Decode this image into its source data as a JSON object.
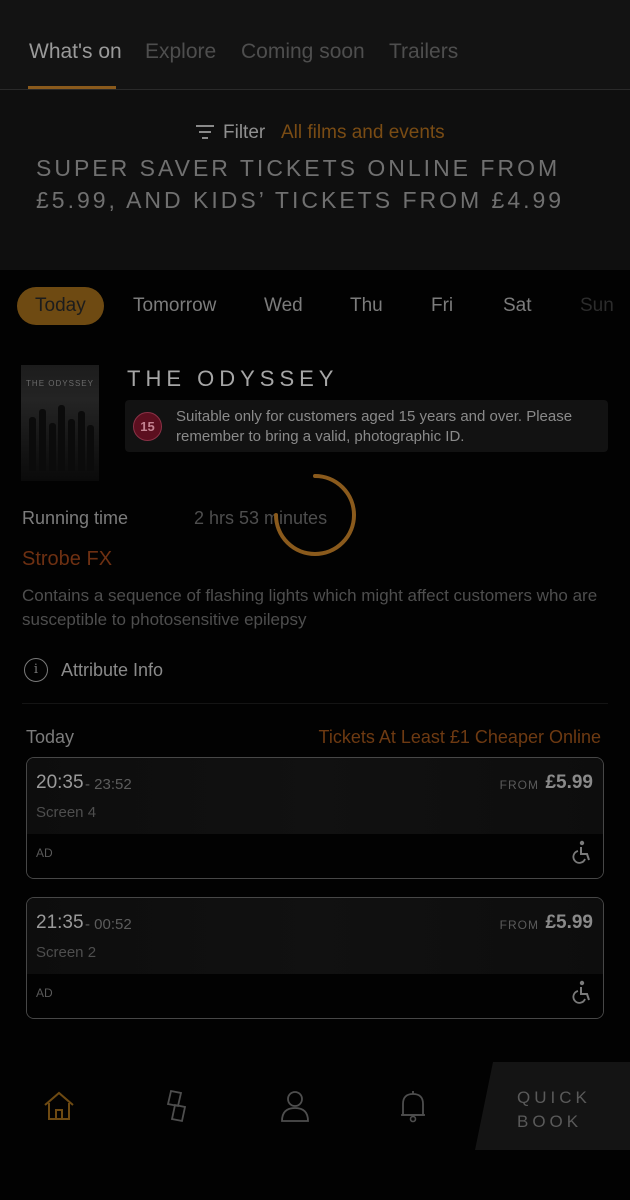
{
  "tabs": [
    {
      "label": "What's on",
      "active": true
    },
    {
      "label": "Explore",
      "active": false
    },
    {
      "label": "Coming soon",
      "active": false
    },
    {
      "label": "Trailers",
      "active": false
    }
  ],
  "filter": {
    "label": "Filter",
    "value": "All films and events"
  },
  "promo": {
    "line1": "SUPER SAVER TICKETS ONLINE FROM",
    "line2": "£5.99, AND KIDS’ TICKETS FROM £4.99"
  },
  "days": [
    {
      "label": "Today",
      "selected": true
    },
    {
      "label": "Tomorrow",
      "selected": false
    },
    {
      "label": "Wed",
      "selected": false
    },
    {
      "label": "Thu",
      "selected": false
    },
    {
      "label": "Fri",
      "selected": false
    },
    {
      "label": "Sat",
      "selected": false
    },
    {
      "label": "Sun",
      "selected": false
    }
  ],
  "film": {
    "title": "THE ODYSSEY",
    "poster_text": "THE ODYSSEY",
    "certificate": "15",
    "certificate_text": "Suitable only for customers aged 15 years and over. Please remember to bring a valid, photographic ID.",
    "running_time_label": "Running time",
    "running_time": "2 hrs 53 minutes",
    "strobe_title": "Strobe FX",
    "strobe_text": "Contains a sequence of flashing lights which might affect customers who are susceptible to photosensitive epilepsy",
    "attribute_info": "Attribute Info"
  },
  "schedule": {
    "day_label": "Today",
    "promo_note": "Tickets At Least £1 Cheaper Online",
    "showtimes": [
      {
        "start": "20:35",
        "end": "- 23:52",
        "screen": "Screen 4",
        "from_label": "FROM",
        "price": "£5.99",
        "tag": "AD"
      },
      {
        "start": "21:35",
        "end": "- 00:52",
        "screen": "Screen 2",
        "from_label": "FROM",
        "price": "£5.99",
        "tag": "AD"
      }
    ]
  },
  "bottom_nav": {
    "items": [
      "home-icon",
      "tickets-icon",
      "account-icon",
      "notifications-icon"
    ],
    "quick_book_line1": "QUICK",
    "quick_book_line2": "BOOK"
  },
  "colors": {
    "accent": "#c98a2e",
    "spinner": "#c98a2e",
    "certificate_15": "#b3204a",
    "background": "#000000"
  },
  "loading": true
}
